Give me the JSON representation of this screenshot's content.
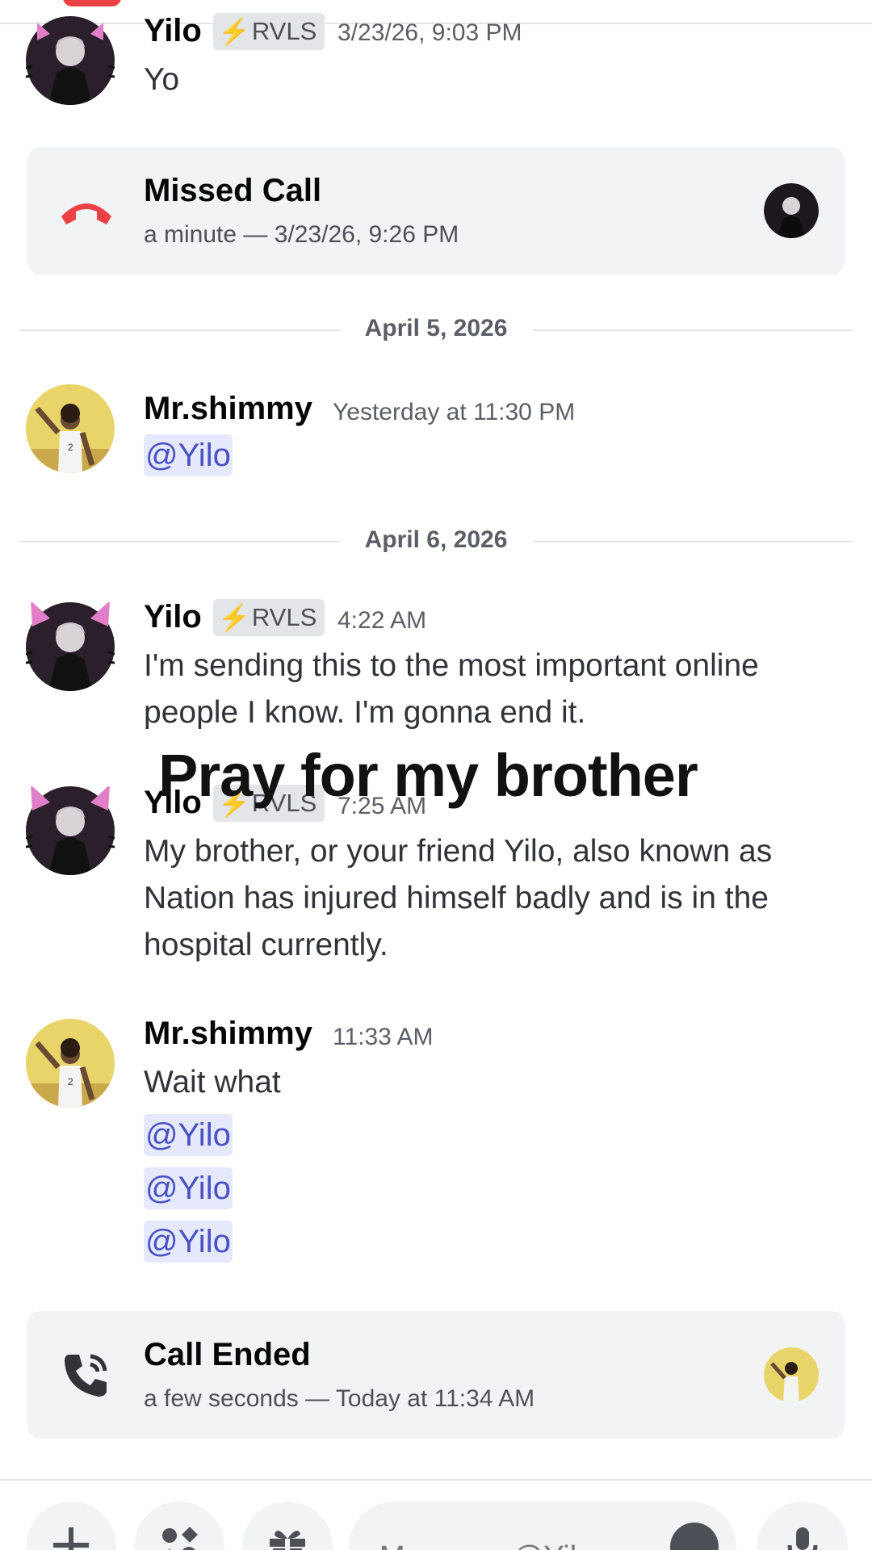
{
  "messages": {
    "m1": {
      "author": "Yilo",
      "badge": "RVLS",
      "time": "3/23/26, 9:03 PM",
      "text": "Yo"
    },
    "missed_call": {
      "title": "Missed Call",
      "subtitle": "a minute — 3/23/26, 9:26 PM"
    },
    "divider1": "April 5, 2026",
    "m2": {
      "author": "Mr.shimmy",
      "time": "Yesterday at 11:30 PM",
      "mention": "@Yilo"
    },
    "divider2": "April 6, 2026",
    "m3": {
      "author": "Yilo",
      "badge": "RVLS",
      "time": "4:22 AM",
      "text": "I'm sending this to the most important online people I know. I'm gonna end it."
    },
    "m4": {
      "author": "Yilo",
      "badge": "RVLS",
      "time": "7:25 AM",
      "text": "My brother, or your friend Yilo, also known as Nation has injured himself badly and is in the hospital currently."
    },
    "m5": {
      "author": "Mr.shimmy",
      "time": "11:33 AM",
      "text": "Wait what",
      "mentions": [
        "@Yilo",
        "@Yilo",
        "@Yilo"
      ]
    },
    "call_ended": {
      "title": "Call Ended",
      "subtitle": "a few seconds — Today at 11:34 AM"
    }
  },
  "overlay_caption": "Pray for my brother",
  "composer": {
    "placeholder": "Message @Yilo"
  },
  "icons": {
    "badge": "lightning-bolt-icon",
    "missed_call": "phone-hangup-icon",
    "call_ended": "phone-call-icon",
    "add": "plus-icon",
    "apps": "apps-icon",
    "gift": "gift-icon",
    "emoji": "emoji-icon",
    "mic": "microphone-icon"
  },
  "colors": {
    "mention_bg": "#e6e8fd",
    "mention_text": "#4752c4",
    "missed_call_red": "#ed4245",
    "badge_bolt": "#f0b232"
  }
}
